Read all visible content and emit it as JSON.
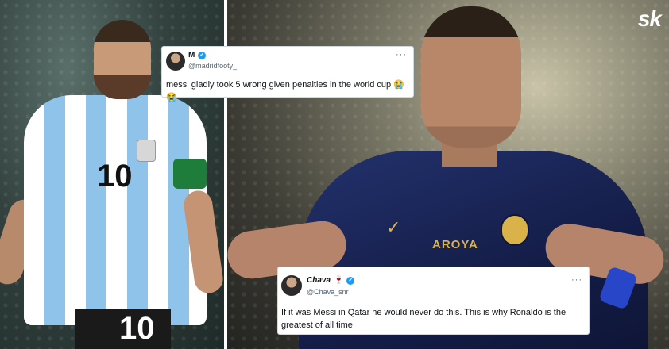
{
  "brand": {
    "logo_text": "sk"
  },
  "tweets": [
    {
      "display_name": "M",
      "handle": "@madridfooty_",
      "text": "messi gladly took 5 wrong given penalties in the world cup 😭😭",
      "verified": true
    },
    {
      "display_name": "Chava",
      "name_emoji": "🍷",
      "handle": "@Chava_snr",
      "text": "If it was Messi in Qatar he would never do this. This is why Ronaldo is the greatest of all time",
      "verified": true
    }
  ],
  "photos": {
    "left": {
      "jersey_number": "10",
      "shorts_number": "10"
    },
    "right": {
      "sponsor_text": "AROYA"
    }
  },
  "colors": {
    "verified_badge": "#1d9bf0",
    "argentina_sky_blue": "#8fc3ea",
    "alnassr_navy": "#141d47",
    "alnassr_gold": "#d9b24a"
  },
  "icons": {
    "verified": "verified-badge-icon",
    "more": "more-options-icon"
  }
}
